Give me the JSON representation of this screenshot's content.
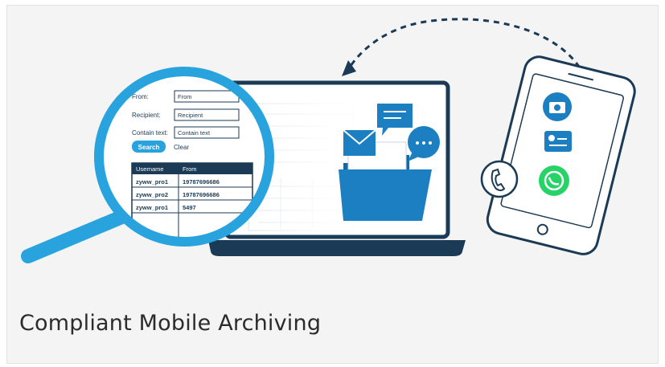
{
  "card": {
    "caption": "Compliant Mobile Archiving"
  },
  "search_panel": {
    "from_label": "From:",
    "from_placeholder": "From",
    "recipient_label": "Recipient:",
    "recipient_placeholder": "Recipient",
    "contain_text_label": "Contain text:",
    "contain_text_placeholder": "Contain text",
    "search_button": "Search",
    "clear_link": "Clear",
    "table": {
      "headers": [
        "Username",
        "From"
      ],
      "rows": [
        [
          "zyww_pro1",
          "19787696686"
        ],
        [
          "zyww_pro2",
          "19787696686"
        ],
        [
          "zyww_pro1",
          "5497"
        ]
      ]
    }
  },
  "colors": {
    "accent": "#29a3dd",
    "dark_navy": "#1b3a55",
    "icon_blue": "#1c7fc1",
    "whatsapp_green": "#25d366"
  },
  "icons": [
    "magnifier-icon",
    "laptop-icon",
    "folder-icon",
    "envelope-icon",
    "chat-bubble-icon",
    "camera-icon",
    "messages-icon",
    "whatsapp-icon",
    "phone-call-icon",
    "sync-arrow-icon"
  ]
}
